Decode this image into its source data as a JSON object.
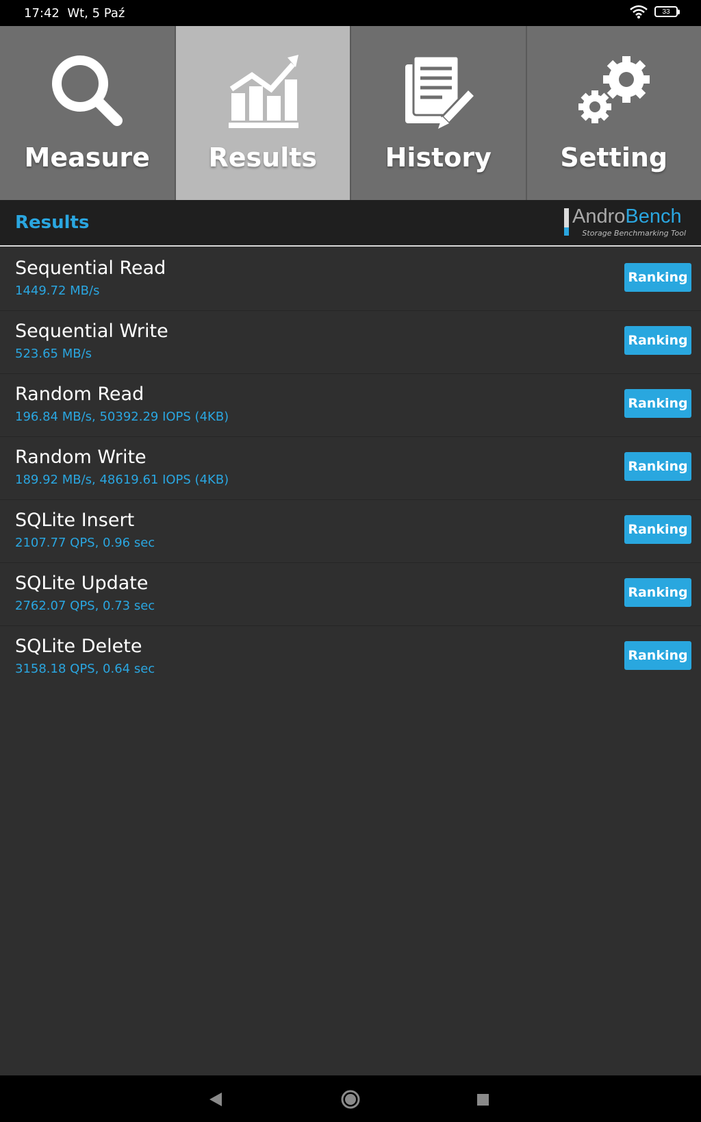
{
  "status_bar": {
    "time": "17:42",
    "date": "Wt, 5 Paź",
    "battery": "33",
    "wifi_icon": "wifi-icon"
  },
  "tabs": [
    {
      "label": "Measure",
      "icon": "magnifier-icon",
      "active": false
    },
    {
      "label": "Results",
      "icon": "chart-growth-icon",
      "active": true
    },
    {
      "label": "History",
      "icon": "document-pen-icon",
      "active": false
    },
    {
      "label": "Setting",
      "icon": "gears-icon",
      "active": false
    }
  ],
  "header": {
    "title": "Results",
    "logo_andro": "Andro",
    "logo_bench": "Bench",
    "logo_subtitle": "Storage Benchmarking Tool"
  },
  "results": [
    {
      "name": "Sequential Read",
      "value": "1449.72 MB/s",
      "button": "Ranking"
    },
    {
      "name": "Sequential Write",
      "value": "523.65 MB/s",
      "button": "Ranking"
    },
    {
      "name": "Random Read",
      "value": "196.84 MB/s, 50392.29 IOPS (4KB)",
      "button": "Ranking"
    },
    {
      "name": "Random Write",
      "value": "189.92 MB/s, 48619.61 IOPS (4KB)",
      "button": "Ranking"
    },
    {
      "name": "SQLite Insert",
      "value": "2107.77 QPS, 0.96 sec",
      "button": "Ranking"
    },
    {
      "name": "SQLite Update",
      "value": "2762.07 QPS, 0.73 sec",
      "button": "Ranking"
    },
    {
      "name": "SQLite Delete",
      "value": "3158.18 QPS, 0.64 sec",
      "button": "Ranking"
    }
  ],
  "colors": {
    "accent": "#29a7df",
    "background": "#2f2f2f",
    "tab_active": "#b9b9b9",
    "tab_inactive": "#6e6e6e"
  }
}
